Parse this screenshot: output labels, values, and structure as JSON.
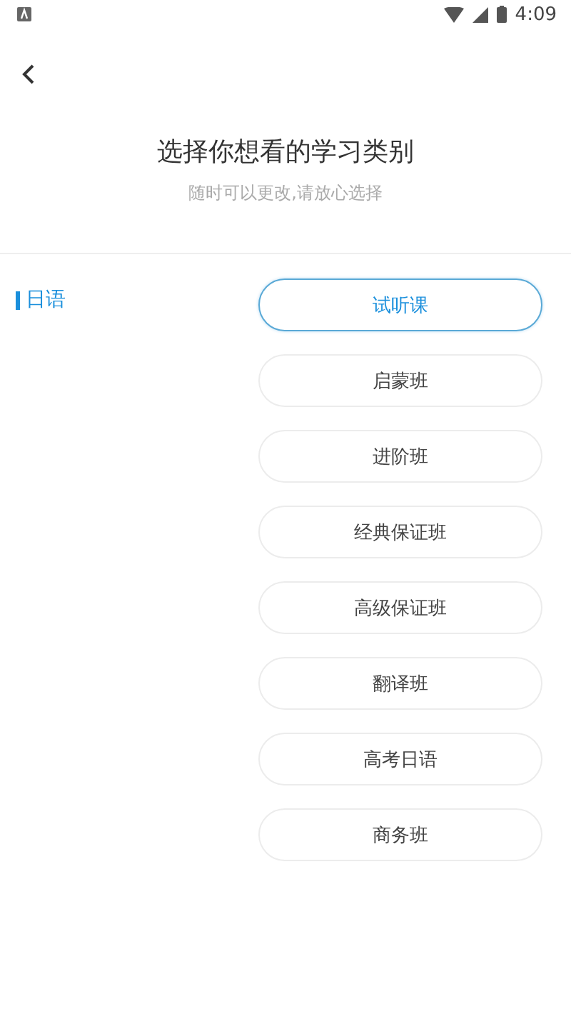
{
  "status_bar": {
    "time": "4:09"
  },
  "title": "选择你想看的学习类别",
  "subtitle": "随时可以更改,请放心选择",
  "categories": [
    {
      "label": "日语",
      "selected": true
    }
  ],
  "options": [
    {
      "label": "试听课",
      "selected": true
    },
    {
      "label": "启蒙班",
      "selected": false
    },
    {
      "label": "进阶班",
      "selected": false
    },
    {
      "label": "经典保证班",
      "selected": false
    },
    {
      "label": "高级保证班",
      "selected": false
    },
    {
      "label": "翻译班",
      "selected": false
    },
    {
      "label": "高考日语",
      "selected": false
    },
    {
      "label": "商务班",
      "selected": false
    }
  ]
}
